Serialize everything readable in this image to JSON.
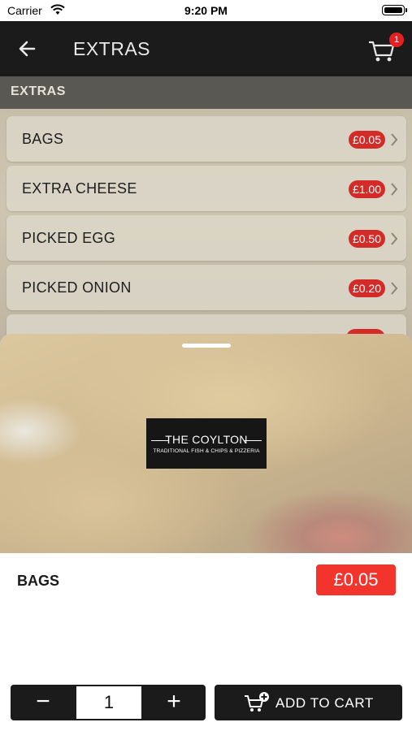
{
  "status_bar": {
    "carrier": "Carrier",
    "time": "9:20 PM"
  },
  "header": {
    "title": "EXTRAS",
    "cart_count": "1",
    "back_icon": "arrow-left-icon",
    "cart_icon": "shopping-cart-icon"
  },
  "section": {
    "label": "EXTRAS"
  },
  "items": [
    {
      "label": "BAGS",
      "price": "£0.05"
    },
    {
      "label": "EXTRA CHEESE",
      "price": "£1.00"
    },
    {
      "label": "PICKED EGG",
      "price": "£0.50"
    },
    {
      "label": "PICKED ONION",
      "price": "£0.20"
    }
  ],
  "sheet": {
    "logo_title": "THE COYLTON",
    "logo_subtitle": "TRADITIONAL FISH & CHIPS & PIZZERIA",
    "product_name": "BAGS",
    "product_price": "£0.05",
    "quantity": "1",
    "minus_label": "−",
    "plus_label": "+",
    "add_to_cart_label": "ADD TO CART"
  },
  "colors": {
    "accent_red": "#f2342c",
    "header_bg": "#1b1b1b"
  }
}
